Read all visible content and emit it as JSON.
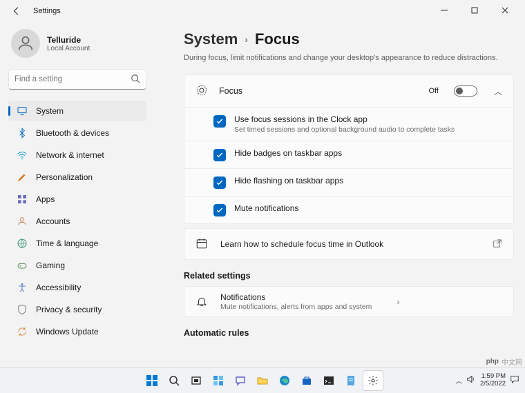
{
  "window": {
    "title": "Settings"
  },
  "user": {
    "name": "Telluride",
    "account": "Local Account"
  },
  "search": {
    "placeholder": "Find a setting"
  },
  "nav": [
    {
      "label": "System",
      "icon": "display",
      "selected": true
    },
    {
      "label": "Bluetooth & devices",
      "icon": "bluetooth"
    },
    {
      "label": "Network & internet",
      "icon": "wifi"
    },
    {
      "label": "Personalization",
      "icon": "brush"
    },
    {
      "label": "Apps",
      "icon": "apps"
    },
    {
      "label": "Accounts",
      "icon": "person"
    },
    {
      "label": "Time & language",
      "icon": "globe"
    },
    {
      "label": "Gaming",
      "icon": "gamepad"
    },
    {
      "label": "Accessibility",
      "icon": "accessibility"
    },
    {
      "label": "Privacy & security",
      "icon": "shield"
    },
    {
      "label": "Windows Update",
      "icon": "update"
    }
  ],
  "breadcrumb": {
    "parent": "System",
    "current": "Focus"
  },
  "description": "During focus, limit notifications and change your desktop's appearance to reduce distractions.",
  "focus": {
    "label": "Focus",
    "state_label": "Off",
    "enabled": false,
    "options": [
      {
        "label": "Use focus sessions in the Clock app",
        "sub": "Set timed sessions and optional background audio to complete tasks",
        "checked": true
      },
      {
        "label": "Hide badges on taskbar apps",
        "checked": true
      },
      {
        "label": "Hide flashing on taskbar apps",
        "checked": true
      },
      {
        "label": "Mute notifications",
        "checked": true
      }
    ]
  },
  "outlook_link": {
    "label": "Learn how to schedule focus time in Outlook"
  },
  "related_heading": "Related settings",
  "notifications_card": {
    "title": "Notifications",
    "sub": "Mute notifications, alerts from apps and system"
  },
  "automatic_heading": "Automatic rules",
  "tray": {
    "time": "1:59 PM",
    "date": "2/5/2022"
  },
  "watermark": "中文网"
}
